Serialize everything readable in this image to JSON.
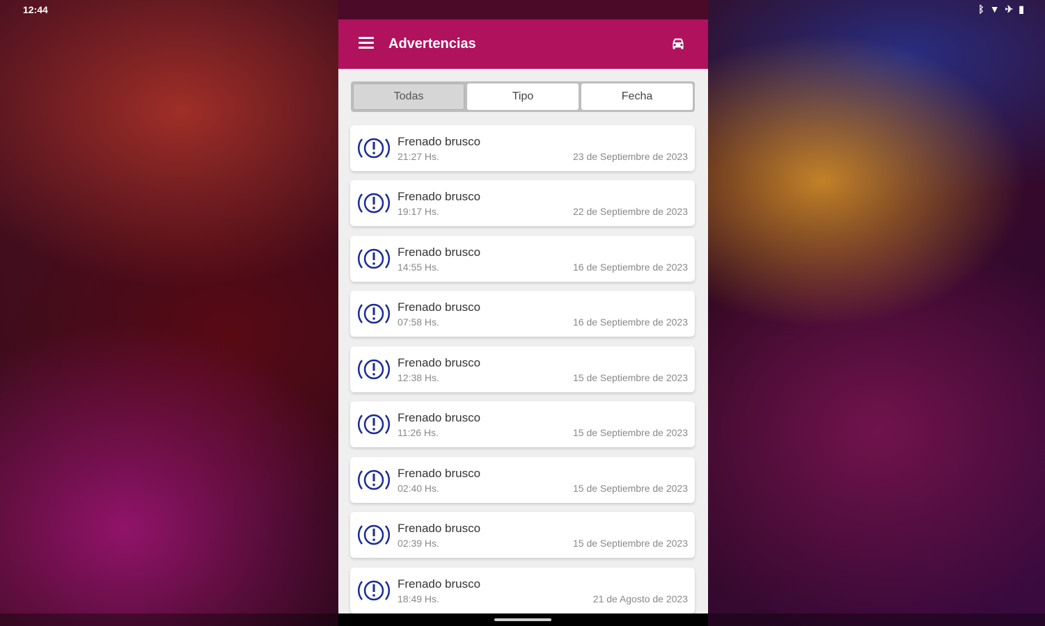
{
  "status": {
    "time": "12:44"
  },
  "appbar": {
    "title": "Advertencias"
  },
  "filters": {
    "all": "Todas",
    "type": "Tipo",
    "date": "Fecha"
  },
  "colors": {
    "primary": "#b0125e",
    "icon": "#1a2a9a"
  },
  "warnings": [
    {
      "title": "Frenado brusco",
      "time": "21:27 Hs.",
      "date": "23 de Septiembre de 2023"
    },
    {
      "title": "Frenado brusco",
      "time": "19:17 Hs.",
      "date": "22 de Septiembre de 2023"
    },
    {
      "title": "Frenado brusco",
      "time": "14:55 Hs.",
      "date": "16 de Septiembre de 2023"
    },
    {
      "title": "Frenado brusco",
      "time": "07:58 Hs.",
      "date": "16 de Septiembre de 2023"
    },
    {
      "title": "Frenado brusco",
      "time": "12:38 Hs.",
      "date": "15 de Septiembre de 2023"
    },
    {
      "title": "Frenado brusco",
      "time": "11:26 Hs.",
      "date": "15 de Septiembre de 2023"
    },
    {
      "title": "Frenado brusco",
      "time": "02:40 Hs.",
      "date": "15 de Septiembre de 2023"
    },
    {
      "title": "Frenado brusco",
      "time": "02:39 Hs.",
      "date": "15 de Septiembre de 2023"
    },
    {
      "title": "Frenado brusco",
      "time": "18:49 Hs.",
      "date": "21 de Agosto de 2023"
    }
  ]
}
